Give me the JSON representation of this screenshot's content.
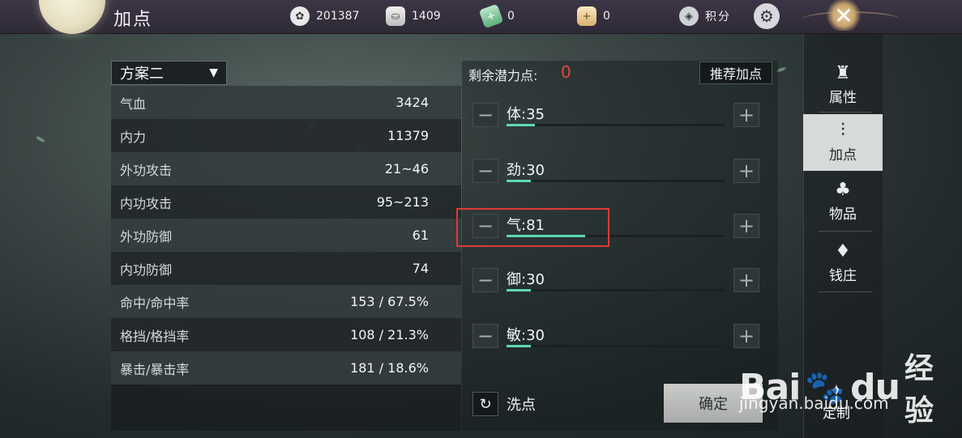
{
  "header": {
    "title": "加点",
    "resources": [
      {
        "icon": "film-reel-icon",
        "value": "201387"
      },
      {
        "icon": "silver-ingot-icon",
        "value": "1409"
      },
      {
        "icon": "jade-add-icon",
        "value": "0"
      },
      {
        "icon": "gold-ingot-add-icon",
        "value": "0"
      }
    ],
    "score_label": "积分"
  },
  "plan": {
    "selected": "方案二"
  },
  "stats": [
    {
      "label": "气血",
      "value": "3424"
    },
    {
      "label": "内力",
      "value": "11379"
    },
    {
      "label": "外功攻击",
      "value": "21~46"
    },
    {
      "label": "内功攻击",
      "value": "95~213"
    },
    {
      "label": "外功防御",
      "value": "61"
    },
    {
      "label": "内功防御",
      "value": "74"
    },
    {
      "label": "命中/命中率",
      "value": "153 / 67.5%"
    },
    {
      "label": "格挡/格挡率",
      "value": "108 / 21.3%"
    },
    {
      "label": "暴击/暴击率",
      "value": "181 / 18.6%"
    }
  ],
  "allocation": {
    "remaining_label": "剩余潜力点:",
    "remaining_value": "0",
    "recommend_label": "推荐加点",
    "attributes": [
      {
        "label": "体:35",
        "level": 0.13
      },
      {
        "label": "劲:30",
        "level": 0.11
      },
      {
        "label": "气:81",
        "level": 0.36
      },
      {
        "label": "御:30",
        "level": 0.11
      },
      {
        "label": "敏:30",
        "level": 0.11
      }
    ],
    "reset_label": "洗点",
    "confirm_label": "确定"
  },
  "tabs": [
    {
      "label": "属性",
      "icon": "attributes-icon"
    },
    {
      "label": "加点",
      "icon": "sliders-icon"
    },
    {
      "label": "物品",
      "icon": "bag-icon"
    },
    {
      "label": "钱庄",
      "icon": "money-bag-icon"
    }
  ],
  "custom_label": "定制",
  "watermark": {
    "brand": "Bai",
    "brand_tail": "du",
    "suffix": "经验",
    "url": "jingyan.baidu.com"
  },
  "colors": {
    "accent_fill": "#5fd7b4",
    "remaining_red": "#e4463c",
    "highlight_red": "#e03a33"
  }
}
